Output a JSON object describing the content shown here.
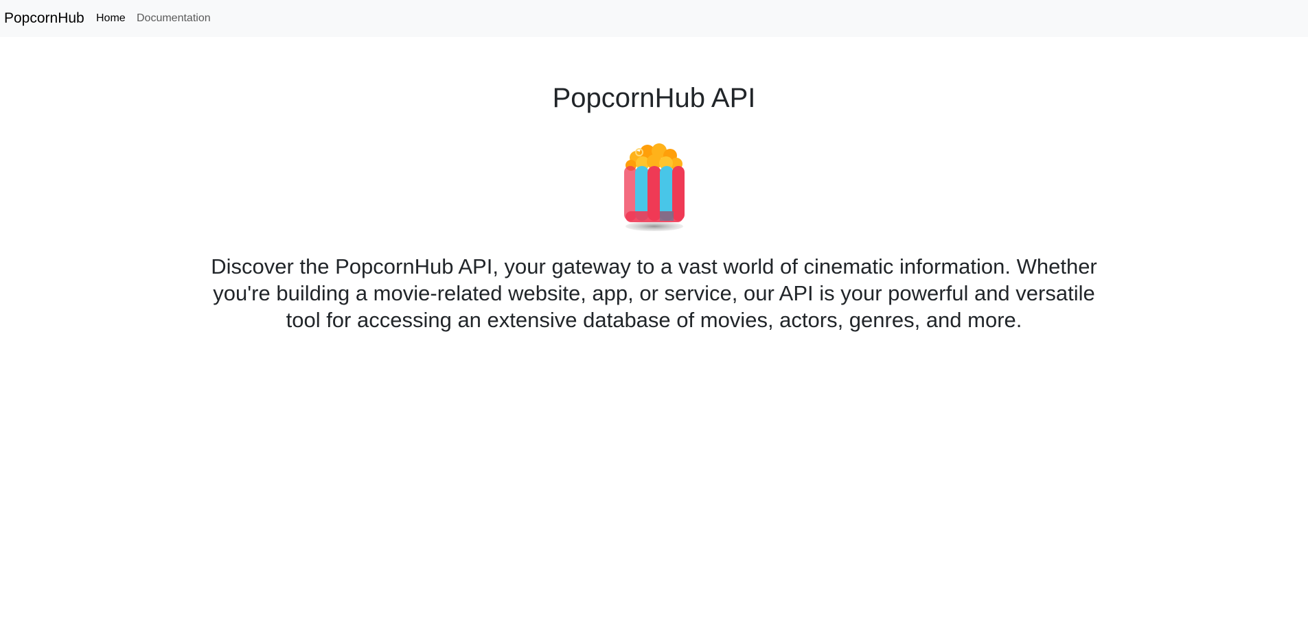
{
  "navbar": {
    "brand": "PopcornHub",
    "links": [
      {
        "label": "Home",
        "active": true
      },
      {
        "label": "Documentation",
        "active": false
      }
    ]
  },
  "hero": {
    "title": "PopcornHub API",
    "logo_icon": "popcorn-icon",
    "description": "Discover the PopcornHub API, your gateway to a vast world of cinematic information. Whether you're building a movie-related website, app, or service, our API is your powerful and versatile tool for accessing an extensive database of movies, actors, genres, and more."
  },
  "colors": {
    "navbar_bg": "#f8f9fa",
    "text": "#212529",
    "popcorn_red": "#ef3a55",
    "popcorn_blue": "#48c6e8",
    "popcorn_kernel": "#ffb21a"
  }
}
